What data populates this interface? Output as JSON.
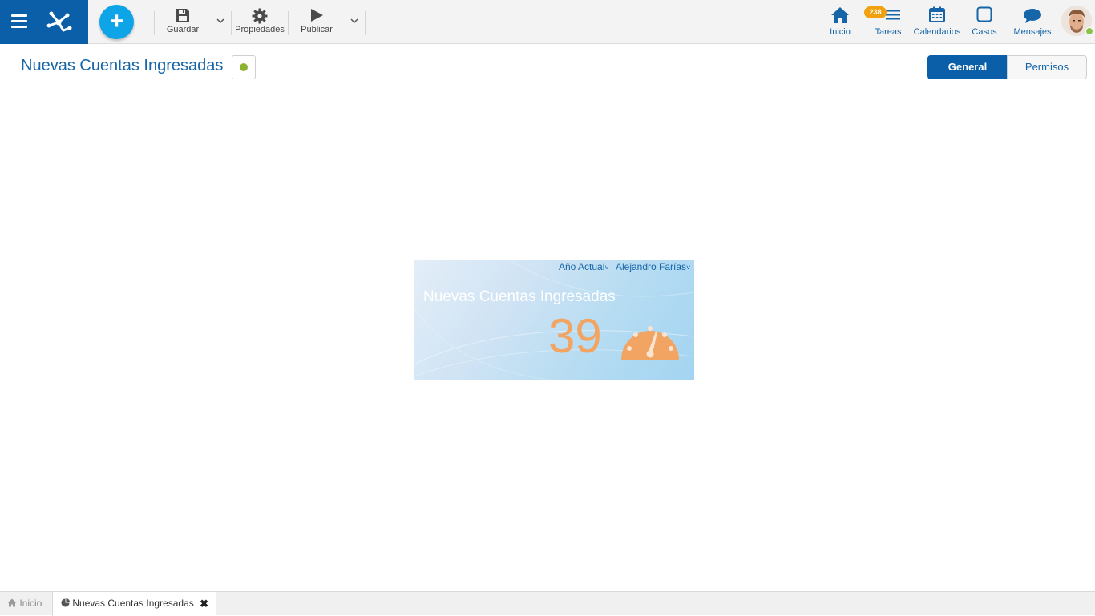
{
  "toolbar": {
    "add_label": "+",
    "save_label": "Guardar",
    "properties_label": "Propiedades",
    "publish_label": "Publicar"
  },
  "nav": {
    "home_label": "Inicio",
    "tasks_label": "Tareas",
    "tasks_badge": "238",
    "calendars_label": "Calendarios",
    "cases_label": "Casos",
    "messages_label": "Mensajes"
  },
  "header": {
    "title": "Nuevas Cuentas Ingresadas",
    "status_color": "#8bb32f"
  },
  "segments": {
    "general": "General",
    "permissions": "Permisos",
    "active": "General"
  },
  "widget": {
    "filter_period": "Año Actual",
    "filter_user": "Alejandro Farías",
    "title": "Nuevas Cuentas Ingresadas",
    "value": "39",
    "icon": "gauge-icon",
    "value_color": "#f2a463"
  },
  "bottom_tabs": {
    "home_label": "Inicio",
    "active_label": "Nuevas Cuentas Ingresadas",
    "close_symbol": "✖"
  },
  "colors": {
    "brand": "#0b5fa8",
    "accent": "#0ea4e8",
    "badge": "#f0a10d"
  }
}
